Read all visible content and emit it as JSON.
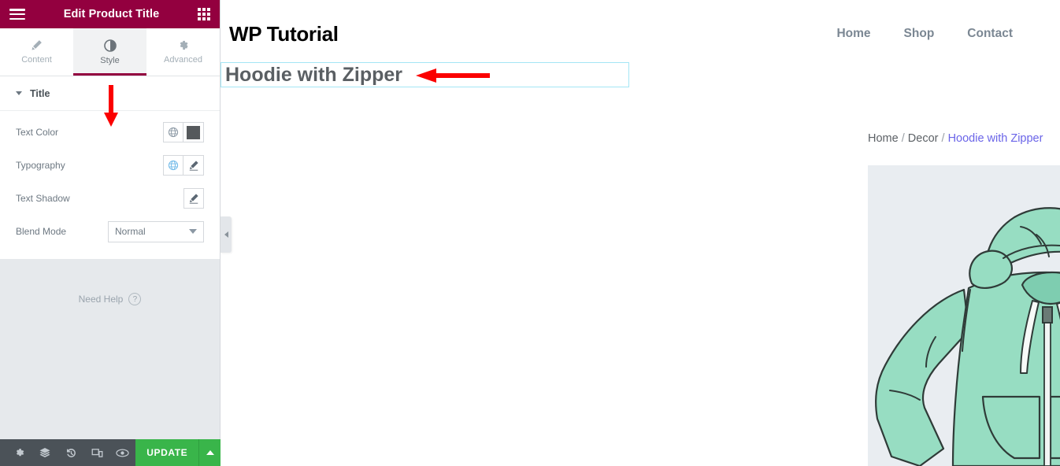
{
  "panel": {
    "header": {
      "title": "Edit Product Title",
      "menu_icon": "hamburger-icon",
      "widgets_icon": "widgets-grid-icon",
      "bg_color": "#93003f"
    },
    "tabs": [
      {
        "label": "Content",
        "icon": "pencil-icon",
        "active": false
      },
      {
        "label": "Style",
        "icon": "contrast-icon",
        "active": true
      },
      {
        "label": "Advanced",
        "icon": "gear-icon",
        "active": false
      }
    ],
    "section": {
      "title": "Title",
      "collapsed": false
    },
    "controls": [
      {
        "label": "Text Color",
        "type": "color",
        "globe": true,
        "swatch_color": "#55595c"
      },
      {
        "label": "Typography",
        "type": "edit",
        "globe": true
      },
      {
        "label": "Text Shadow",
        "type": "edit",
        "globe": false
      },
      {
        "label": "Blend Mode",
        "type": "select",
        "value": "Normal"
      }
    ],
    "need_help": {
      "label": "Need Help",
      "icon": "question-circle-icon"
    },
    "footer": {
      "icons": [
        "settings-gear-icon",
        "navigator-layers-icon",
        "history-icon",
        "responsive-mode-icon",
        "preview-eye-icon"
      ],
      "update_label": "UPDATE",
      "update_color": "#39b54a",
      "caret_icon": "caret-up-icon"
    },
    "annotation": {
      "arrow": "red-down-arrow",
      "color": "#fb0000"
    }
  },
  "canvas": {
    "site": {
      "logo": "WP Tutorial",
      "nav": [
        "Home",
        "Shop",
        "Contact"
      ]
    },
    "product": {
      "title": "Hoodie with Zipper",
      "title_color": "#5a5f63",
      "selection_border": "#a4e6f5",
      "breadcrumb": {
        "items": [
          "Home",
          "Decor",
          "Hoodie with Zipper"
        ],
        "separator": "/",
        "current_color": "#6a64e8"
      },
      "image": {
        "alt": "mint green zip-up hoodie illustration",
        "bg_color": "#e9edf1",
        "garment_color": "#97ddc2",
        "zoom_icon": "magnifier-icon"
      }
    },
    "annotation": {
      "arrow": "red-left-arrow",
      "color": "#fb0000"
    },
    "collapse_handle": {
      "icon": "chevron-left-icon"
    }
  }
}
